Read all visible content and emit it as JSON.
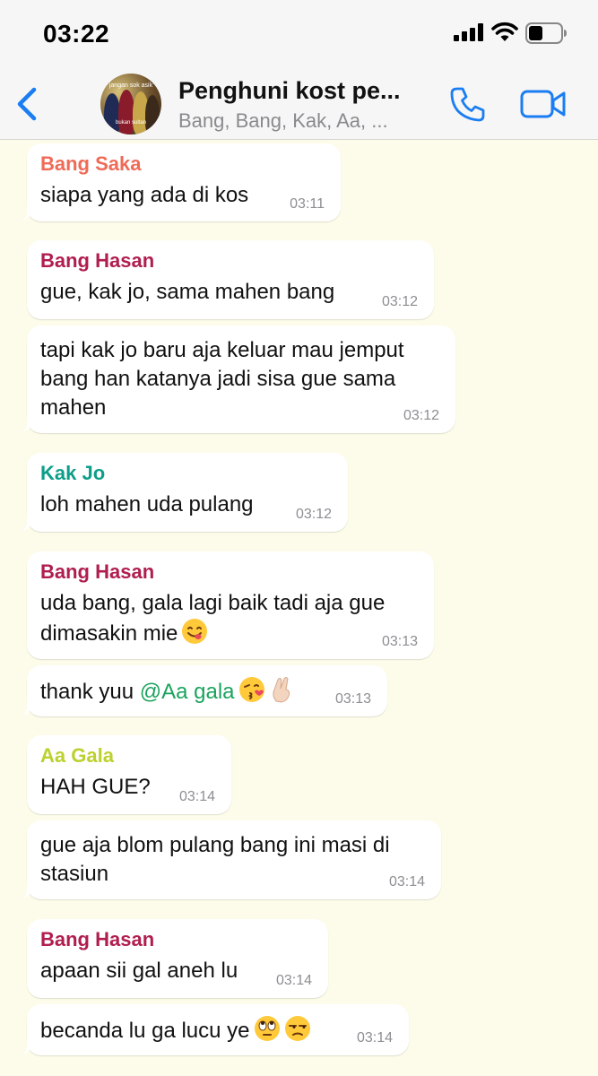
{
  "status_bar": {
    "time": "03:22"
  },
  "header": {
    "title": "Penghuni kost pe...",
    "subtitle": "Bang, Bang, Kak, Aa, ...",
    "avatar_caption_top": "jangan sok asik",
    "avatar_caption_bottom": "bukan sultan",
    "accent_color": "#1a7df2"
  },
  "colors": {
    "background": "#fdfcea",
    "bubble": "#ffffff",
    "sender_saka": "#ef6b58",
    "sender_hasan": "#b01d4f",
    "sender_jo": "#0d9e8a",
    "sender_gala": "#bcd12e",
    "mention": "#1aa35d"
  },
  "messages": [
    {
      "sender": "Bang Saka",
      "text": "siapa yang ada di kos",
      "time": "03:11"
    },
    {
      "sender": "Bang Hasan",
      "text": "gue, kak jo, sama mahen bang",
      "time": "03:12"
    },
    {
      "line1": "tapi kak jo baru aja keluar mau jemput",
      "line2": "bang han katanya jadi sisa gue sama",
      "line3": "mahen",
      "time": "03:12"
    },
    {
      "sender": "Kak Jo",
      "text": "loh mahen uda pulang",
      "time": "03:12"
    },
    {
      "sender": "Bang Hasan",
      "line1": "uda bang, gala lagi baik tadi aja gue",
      "line2": "dimasakin mie",
      "emoji": "yum-face-emoji",
      "time": "03:13"
    },
    {
      "text_prefix": "thank yuu ",
      "mention": "@Aa gala",
      "emoji": [
        "kissing-face-emoji",
        "crossed-fingers-emoji"
      ],
      "time": "03:13"
    },
    {
      "sender": "Aa Gala",
      "text": "HAH GUE?",
      "time": "03:14"
    },
    {
      "line1": "gue aja blom pulang bang ini masi di",
      "line2": "stasiun",
      "time": "03:14"
    },
    {
      "sender": "Bang Hasan",
      "text": "apaan sii gal aneh lu",
      "time": "03:14"
    },
    {
      "text": "becanda lu ga lucu ye",
      "emoji": [
        "eye-roll-emoji",
        "unamused-face-emoji"
      ],
      "time": "03:14"
    }
  ]
}
